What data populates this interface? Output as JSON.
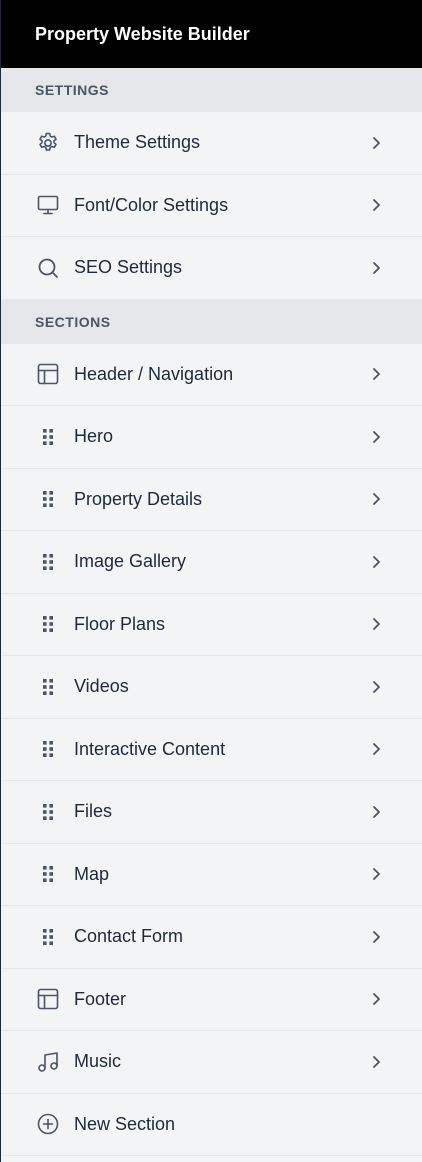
{
  "app": {
    "title": "Property Website Builder"
  },
  "settings": {
    "header": "SETTINGS",
    "items": [
      {
        "label": "Theme Settings",
        "icon": "gear-icon"
      },
      {
        "label": "Font/Color Settings",
        "icon": "monitor-icon"
      },
      {
        "label": "SEO Settings",
        "icon": "search-icon"
      }
    ]
  },
  "sections": {
    "header": "SECTIONS",
    "items": [
      {
        "label": "Header / Navigation",
        "icon": "layout-icon"
      },
      {
        "label": "Hero",
        "icon": "drag-handle-icon"
      },
      {
        "label": "Property Details",
        "icon": "drag-handle-icon"
      },
      {
        "label": "Image Gallery",
        "icon": "drag-handle-icon"
      },
      {
        "label": "Floor Plans",
        "icon": "drag-handle-icon"
      },
      {
        "label": "Videos",
        "icon": "drag-handle-icon"
      },
      {
        "label": "Interactive Content",
        "icon": "drag-handle-icon"
      },
      {
        "label": "Files",
        "icon": "drag-handle-icon"
      },
      {
        "label": "Map",
        "icon": "drag-handle-icon"
      },
      {
        "label": "Contact Form",
        "icon": "drag-handle-icon"
      },
      {
        "label": "Footer",
        "icon": "layout-icon"
      },
      {
        "label": "Music",
        "icon": "music-icon"
      }
    ],
    "new_section_label": "New Section"
  },
  "colors": {
    "titlebar_bg": "#000000",
    "panel_bg": "#f3f4f6",
    "section_header_bg": "#e5e7eb",
    "icon": "#4b5563",
    "text": "#1f2937"
  }
}
